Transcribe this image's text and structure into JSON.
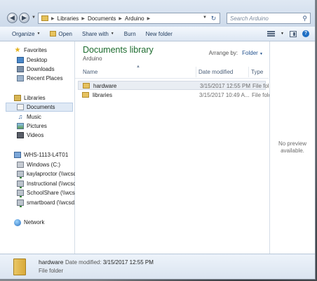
{
  "address_bar": {
    "breadcrumb": [
      "Libraries",
      "Documents",
      "Arduino"
    ],
    "search_placeholder": "Search Arduino"
  },
  "toolbar": {
    "organize": "Organize",
    "open": "Open",
    "share_with": "Share with",
    "burn": "Burn",
    "new_folder": "New folder"
  },
  "sidebar": {
    "favorites": {
      "label": "Favorites",
      "items": [
        "Desktop",
        "Downloads",
        "Recent Places"
      ]
    },
    "libraries": {
      "label": "Libraries",
      "items": [
        "Documents",
        "Music",
        "Pictures",
        "Videos"
      ],
      "selected": "Documents"
    },
    "computer": {
      "label": "WHS-1113-L4T01",
      "items": [
        "Windows (C:)",
        "kaylaproctor (\\\\wcsd",
        "Instructional (\\\\wcsd",
        "SchoolShare (\\\\wcsd",
        "smartboard (\\\\wcsd.\\"
      ]
    },
    "network": {
      "label": "Network"
    }
  },
  "library_header": {
    "title": "Documents library",
    "subtitle": "Arduino",
    "arrange_label": "Arrange by:",
    "arrange_value": "Folder"
  },
  "columns": {
    "name": "Name",
    "date_modified": "Date modified",
    "type": "Type"
  },
  "files": [
    {
      "name": "hardware",
      "date": "3/15/2017 12:55 PM",
      "type": "File folder",
      "selected": true
    },
    {
      "name": "libraries",
      "date": "3/15/2017 10:49 A...",
      "type": "File folder",
      "selected": false
    }
  ],
  "preview": {
    "line1": "No preview",
    "line2": "available."
  },
  "details_pane": {
    "name": "hardware",
    "modified_label": "Date modified:",
    "modified_value": "3/15/2017 12:55 PM",
    "type": "File folder"
  },
  "colors": {
    "library_title": "#1c6b2e",
    "selection": "#dfe9f5",
    "folder": "#e6c260"
  }
}
